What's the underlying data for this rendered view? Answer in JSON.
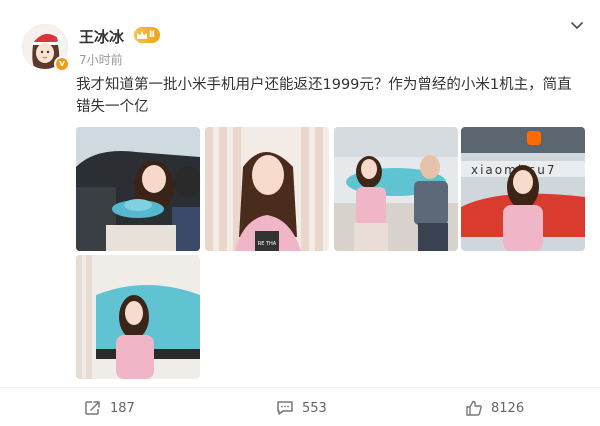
{
  "post": {
    "username": "王冰冰",
    "vip_level": "Ⅱ",
    "timestamp": "7小时前",
    "text": "我才知道第一批小米手机用户还能返还1999元？作为曾经的小米1机主，简直错失一个亿",
    "verified_badge": "v"
  },
  "images": [
    {
      "alt": "photo-1",
      "logo_text": ""
    },
    {
      "alt": "photo-2",
      "logo_text": "RE THA"
    },
    {
      "alt": "photo-3",
      "logo_text": ""
    },
    {
      "alt": "photo-4",
      "logo_text": "xiaomi su7"
    },
    {
      "alt": "photo-5",
      "logo_text": ""
    }
  ],
  "actions": {
    "repost_count": "187",
    "comment_count": "553",
    "like_count": "8126"
  },
  "icons": {
    "dropdown": "chevron-down-icon",
    "repost": "repost-icon",
    "comment": "comment-icon",
    "like": "thumbs-up-icon"
  },
  "colors": {
    "vip_gold": "#f0a21b",
    "verify_orange": "#f39a14",
    "car_teal": "#5fc3d2",
    "pink_outfit": "#f0b6c8"
  }
}
